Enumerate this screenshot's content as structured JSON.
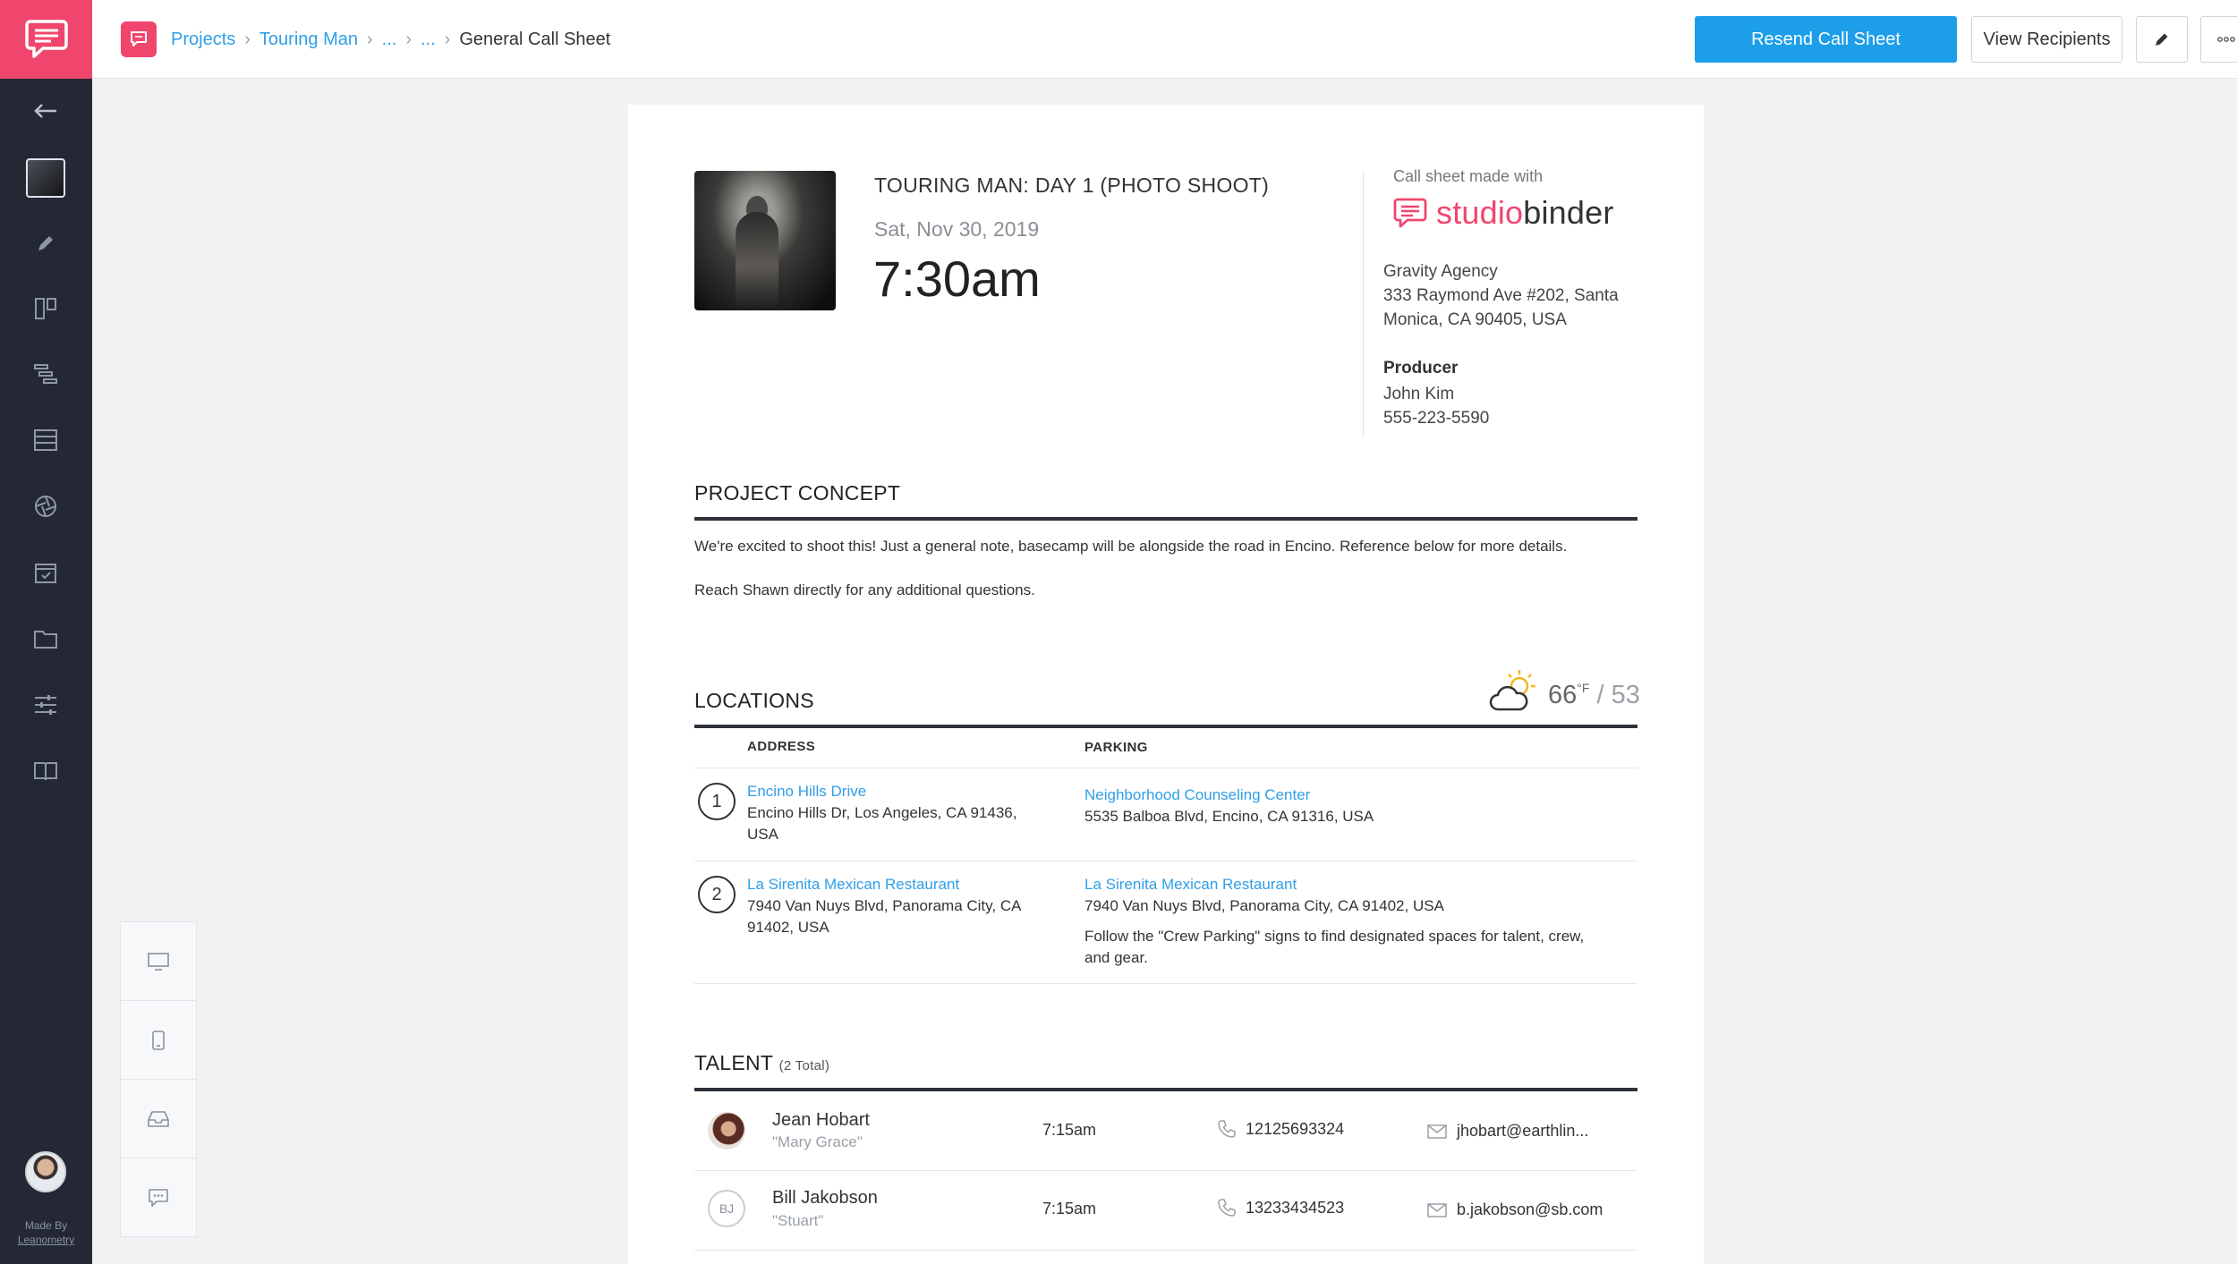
{
  "sidebar": {
    "made_by_label": "Made By",
    "made_by_name": "Leanometry"
  },
  "breadcrumb": {
    "projects": "Projects",
    "project": "Touring Man",
    "ellipsis_1": "...",
    "ellipsis_2": "...",
    "current": "General Call Sheet"
  },
  "toolbar": {
    "resend_label": "Resend Call Sheet",
    "view_recipients_label": "View Recipients"
  },
  "event": {
    "title": "TOURING MAN: DAY 1 (PHOTO SHOOT)",
    "date": "Sat, Nov 30, 2019",
    "time": "7:30am"
  },
  "brand": {
    "made_with": "Call sheet made with",
    "logo_studio": "studio",
    "logo_binder": "binder",
    "accent": "#f0466d"
  },
  "company": {
    "name": "Gravity Agency",
    "address": "333 Raymond Ave #202, Santa Monica, CA 90405, USA"
  },
  "producer": {
    "label": "Producer",
    "name": "John Kim",
    "phone": "555-223-5590"
  },
  "concept": {
    "title": "PROJECT CONCEPT",
    "paragraph_1": "We're excited to shoot this! Just a general note, basecamp will be alongside the road in Encino. Reference below for more details.",
    "paragraph_2": "Reach Shawn directly for any additional questions."
  },
  "locations": {
    "title": "LOCATIONS",
    "weather": {
      "icon": "partly-cloudy-icon",
      "high": "66",
      "unit": "°F",
      "low": "53"
    },
    "headers": {
      "address": "ADDRESS",
      "parking": "PARKING"
    },
    "rows": [
      {
        "number": "1",
        "address_name": "Encino Hills Drive",
        "address": "Encino Hills Dr, Los Angeles, CA 91436, USA",
        "parking_name": "Neighborhood Counseling Center",
        "parking_address": "5535 Balboa Blvd, Encino, CA 91316, USA",
        "parking_note": ""
      },
      {
        "number": "2",
        "address_name": "La Sirenita Mexican Restaurant",
        "address": "7940 Van Nuys Blvd, Panorama City, CA 91402, USA",
        "parking_name": "La Sirenita Mexican Restaurant",
        "parking_address": "7940 Van Nuys Blvd, Panorama City, CA 91402, USA",
        "parking_note": "Follow the \"Crew Parking\" signs to find designated spaces for talent, crew, and gear."
      }
    ]
  },
  "talent": {
    "title": "TALENT",
    "count": "(2 Total)",
    "rows": [
      {
        "initials": "",
        "name": "Jean Hobart",
        "role": "\"Mary Grace\"",
        "time": "7:15am",
        "phone": "12125693324",
        "email": "jhobart@earthlin..."
      },
      {
        "initials": "BJ",
        "name": "Bill Jakobson",
        "role": "\"Stuart\"",
        "time": "7:15am",
        "phone": "13233434523",
        "email": "b.jakobson@sb.com"
      }
    ]
  }
}
